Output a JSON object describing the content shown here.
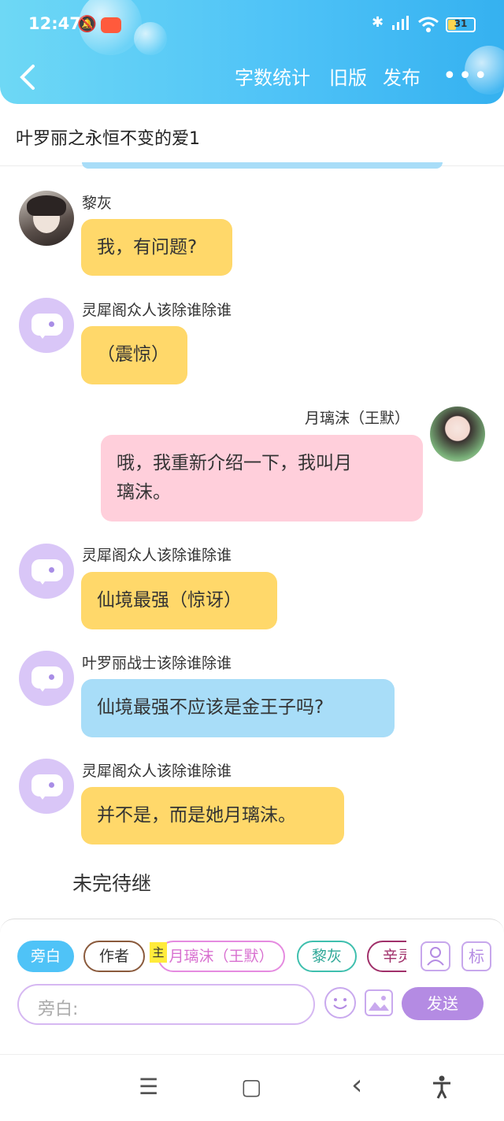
{
  "status": {
    "time": "12:47",
    "battery": "31"
  },
  "header": {
    "back_icon": "chevron-left-icon",
    "actions": [
      "字数统计",
      "旧版",
      "发布"
    ],
    "more": "•••"
  },
  "title": "叶罗丽之永恒不变的爱1",
  "messages": [
    {
      "name": "黎灰",
      "text": "我，有问题?"
    },
    {
      "name": "灵犀阁众人该除谁除谁",
      "text": "（震惊）"
    },
    {
      "name": "月璃沫（王默）",
      "text_line1": "哦，我重新介绍一下，我叫月",
      "text_line2": "璃沫。"
    },
    {
      "name": "灵犀阁众人该除谁除谁",
      "text": "仙境最强（惊讶）"
    },
    {
      "name": "叶罗丽战士该除谁除谁",
      "text": "仙境最强不应该是金王子吗?"
    },
    {
      "name": "灵犀阁众人该除谁除谁",
      "text": "并不是，而是她月璃沫。"
    }
  ],
  "to_be_continued": "未完待继",
  "composer": {
    "chips": [
      "旁白",
      "作者",
      "月璃沫（王默）",
      "黎灰",
      "辛灵"
    ],
    "main_tag": "主",
    "mark_label": "标",
    "placeholder": "旁白:",
    "send_label": "发送"
  },
  "colors": {
    "header": "#4fc3f7",
    "yellow_bubble": "#ffd86a",
    "blue_bubble": "#a8ddf8",
    "pink_bubble": "#ffcfdb",
    "accent_purple": "#b48be3"
  },
  "system_nav": {
    "menu": "☰",
    "home": "▢",
    "back": "‹",
    "accessibility": "accessibility-icon"
  }
}
